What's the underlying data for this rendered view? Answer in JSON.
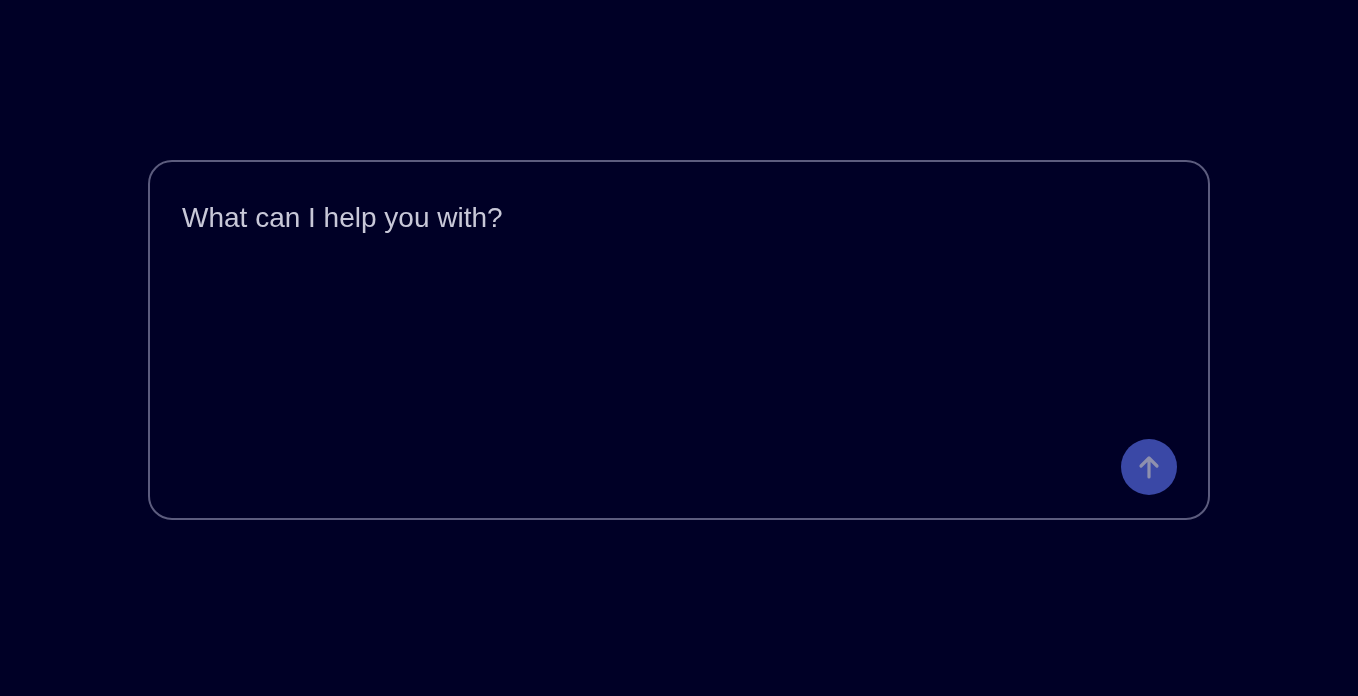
{
  "prompt": {
    "placeholder": "What can I help you with?"
  },
  "send_button": {
    "disabled": true
  }
}
